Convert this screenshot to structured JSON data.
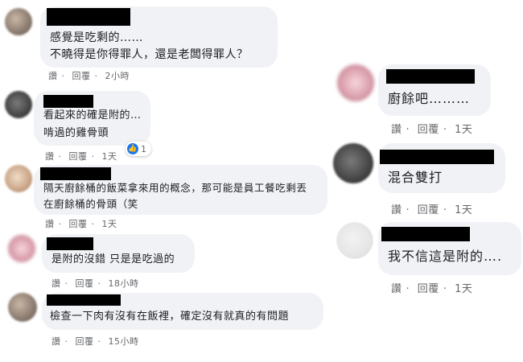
{
  "left_comments": [
    {
      "lines": [
        "感覺是吃剩的……",
        "不曉得是你得罪人，還是老闆得罪人？"
      ],
      "actions": [
        "讚",
        "回覆",
        "2小時"
      ]
    },
    {
      "lines": [
        "看起來的確是附的…",
        "啃過的雞骨頭"
      ],
      "actions": [
        "讚",
        "回覆",
        "1天"
      ],
      "reaction_count": "1"
    },
    {
      "lines": [
        "隔天廚餘桶的飯菜拿來用的概念，那可能是員工餐吃剩丟",
        "在廚餘桶的骨頭（笑"
      ],
      "actions": [
        "讚",
        "回覆",
        "1天"
      ]
    },
    {
      "lines": [
        "是附的沒錯 只是是吃過的"
      ],
      "actions": [
        "讚",
        "回覆",
        "18小時"
      ]
    },
    {
      "lines": [
        "檢查一下肉有沒有在飯裡，確定沒有就真的有問題"
      ],
      "actions": [
        "讚",
        "回覆",
        "15小時"
      ]
    }
  ],
  "right_comments": [
    {
      "lines": [
        "廚餘吧………"
      ],
      "actions": [
        "讚",
        "回覆",
        "1天"
      ]
    },
    {
      "lines": [
        "混合雙打"
      ],
      "actions": [
        "讚",
        "回覆",
        "1天"
      ]
    },
    {
      "lines": [
        "我不信這是附的…."
      ],
      "actions": [
        "讚",
        "回覆",
        "1天"
      ]
    }
  ],
  "action_separator": "·",
  "colors": {
    "bubble": "#f0f2f5",
    "text": "#1c1e21",
    "meta": "#65676b",
    "like": "#1877f2"
  },
  "icons": {
    "reaction": "thumbs-up-icon"
  }
}
